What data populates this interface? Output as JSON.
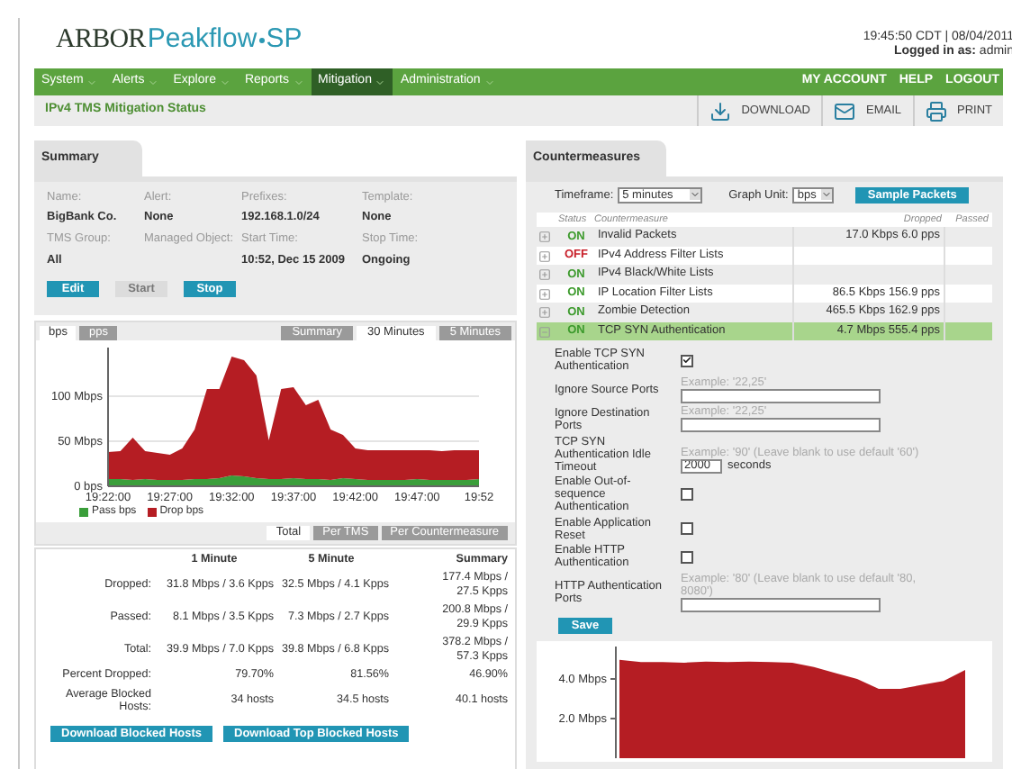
{
  "header": {
    "logo_brand": "ARBOR",
    "logo_product": "Peakflow",
    "logo_suffix": "SP",
    "datetime": "19:45:50 CDT | 08/04/2011",
    "login_label": "Logged in as:",
    "login_user": "admin"
  },
  "nav": {
    "menus": [
      {
        "label": "System",
        "selected": false
      },
      {
        "label": "Alerts",
        "selected": false
      },
      {
        "label": "Explore",
        "selected": false
      },
      {
        "label": "Reports",
        "selected": false
      },
      {
        "label": "Mitigation",
        "selected": true
      },
      {
        "label": "Administration",
        "selected": false
      }
    ],
    "links": [
      "MY ACCOUNT",
      "HELP",
      "LOGOUT"
    ]
  },
  "toolbar": {
    "title": "IPv4 TMS Mitigation Status",
    "actions": [
      {
        "kind": "download",
        "label": "DOWNLOAD"
      },
      {
        "kind": "email",
        "label": "EMAIL"
      },
      {
        "kind": "print",
        "label": "PRINT"
      }
    ]
  },
  "summary": {
    "tab": "Summary",
    "fields": [
      {
        "label": "Name:",
        "value": "BigBank Co."
      },
      {
        "label": "Alert:",
        "value": "None"
      },
      {
        "label": "Prefixes:",
        "value": "192.168.1.0/24"
      },
      {
        "label": "Template:",
        "value": "None"
      },
      {
        "label": "TMS Group:",
        "value": "All"
      },
      {
        "label": "Managed Object:"
      },
      {
        "label": "Start Time:",
        "value": "10:52, Dec 15 2009"
      },
      {
        "label": "Stop Time:",
        "value": "Ongoing"
      }
    ],
    "buttons": [
      {
        "label": "Edit",
        "disabled": false
      },
      {
        "label": "Start",
        "disabled": true
      },
      {
        "label": "Stop",
        "disabled": false
      }
    ]
  },
  "graph": {
    "unit_tabs": [
      {
        "label": "bps",
        "selected": true
      },
      {
        "label": "pps",
        "selected": false
      }
    ],
    "range_tabs": [
      {
        "label": "Summary",
        "selected": false
      },
      {
        "label": "30 Minutes",
        "selected": true
      },
      {
        "label": "5 Minutes",
        "selected": false
      }
    ],
    "chart_data": {
      "type": "area",
      "stacked": true,
      "categories": [
        "19:22:00",
        null,
        null,
        null,
        null,
        "19:27:00",
        null,
        null,
        null,
        null,
        "19:32:00",
        null,
        null,
        null,
        null,
        "19:37:00",
        null,
        null,
        null,
        null,
        "19:42:00",
        null,
        null,
        null,
        null,
        "19:47:00",
        null,
        null,
        null,
        null,
        "19:52"
      ],
      "ylim": [
        0,
        150
      ],
      "yticks": [
        {
          "value": 0,
          "label": "0 bps"
        },
        {
          "value": 50,
          "label": "50 Mbps"
        },
        {
          "value": 100,
          "label": "100 Mbps"
        }
      ],
      "series": [
        {
          "name": "Pass bps",
          "color": "#3a9e3a",
          "values": [
            8,
            8,
            7,
            8,
            7,
            7,
            7,
            8,
            8,
            9,
            12,
            11,
            9,
            8,
            8,
            9,
            8,
            8,
            7,
            9,
            8,
            7,
            7,
            7,
            7,
            8,
            7,
            7,
            7,
            7,
            8
          ]
        },
        {
          "name": "Drop bps",
          "color": "#b51d23",
          "values": [
            30,
            31,
            47,
            31,
            30,
            28,
            35,
            55,
            100,
            99,
            132,
            129,
            114,
            43,
            100,
            101,
            82,
            88,
            56,
            48,
            34,
            33,
            33,
            33,
            33,
            32,
            33,
            32,
            33,
            33,
            32
          ]
        }
      ]
    },
    "view_tabs": [
      {
        "label": "Total",
        "selected": true
      },
      {
        "label": "Per TMS",
        "selected": false
      },
      {
        "label": "Per Countermeasure",
        "selected": false
      }
    ]
  },
  "stats": {
    "columns": [
      "1 Minute",
      "5 Minute",
      "Summary"
    ],
    "rows": [
      {
        "label": "Dropped:",
        "cells": [
          "31.8 Mbps / 3.6 Kpps",
          "32.5 Mbps / 4.1 Kpps",
          "177.4 Mbps / 27.5 Kpps"
        ]
      },
      {
        "label": "Passed:",
        "cells": [
          "8.1 Mbps / 3.5 Kpps",
          "7.3 Mbps / 2.7 Kpps",
          "200.8 Mbps / 29.9 Kpps"
        ]
      },
      {
        "label": "Total:",
        "cells": [
          "39.9 Mbps / 7.0 Kpps",
          "39.8 Mbps / 6.8 Kpps",
          "378.2 Mbps / 57.3 Kpps"
        ]
      },
      {
        "label": "Percent Dropped:",
        "cells": [
          "79.70%",
          "81.56%",
          "46.90%"
        ]
      },
      {
        "label": "Average Blocked Hosts:",
        "cells": [
          "34  hosts",
          "34.5  hosts",
          "40.1  hosts"
        ]
      }
    ],
    "buttons": [
      "Download Blocked Hosts",
      "Download Top Blocked Hosts"
    ]
  },
  "countermeasures": {
    "tab": "Countermeasures",
    "timeframe_label": "Timeframe:",
    "timeframe": "5 minutes",
    "unit_label": "Graph Unit:",
    "unit": "bps",
    "sample_button": "Sample Packets",
    "columns": [
      "Status",
      "Countermeasure",
      "Dropped",
      "Passed"
    ],
    "rows": [
      {
        "status": "ON",
        "on": true,
        "name": "Invalid Packets",
        "dropped": "17.0 Kbps 6.0 pps",
        "expanded": false
      },
      {
        "status": "OFF",
        "on": false,
        "name": "IPv4 Address Filter Lists",
        "expanded": false
      },
      {
        "status": "ON",
        "on": true,
        "name": "IPv4 Black/White Lists",
        "expanded": false
      },
      {
        "status": "ON",
        "on": true,
        "name": "IP Location Filter Lists",
        "dropped": "86.5 Kbps 156.9 pps",
        "expanded": false
      },
      {
        "status": "ON",
        "on": true,
        "name": "Zombie Detection",
        "dropped": "465.5 Kbps 162.9 pps",
        "expanded": false
      },
      {
        "status": "ON",
        "on": true,
        "name": "TCP SYN Authentication",
        "dropped": "4.7 Mbps 555.4 pps",
        "expanded": true
      }
    ],
    "settings": [
      {
        "kind": "checkbox",
        "label": "Enable TCP SYN Authentication",
        "checked": true
      },
      {
        "kind": "text",
        "label": "Ignore Source Ports",
        "example": "Example:  '22,25'"
      },
      {
        "kind": "text",
        "label": "Ignore Destination Ports",
        "example": "Example:  '22,25'"
      },
      {
        "kind": "text",
        "label": "TCP SYN Authentication Idle Timeout",
        "example": "Example: '90' (Leave blank to use default '60')",
        "value": "2000",
        "unit": "seconds"
      },
      {
        "kind": "checkbox",
        "label": "Enable Out-of-sequence Authentication",
        "checked": false
      },
      {
        "kind": "checkbox",
        "label": "Enable Application Reset",
        "checked": false
      },
      {
        "kind": "checkbox",
        "label": "Enable HTTP Authentication",
        "checked": false
      },
      {
        "kind": "text",
        "label": "HTTP Authentication Ports",
        "example": "Example: '80' (Leave blank to use default '80, 8080')"
      }
    ],
    "save_button": "Save",
    "traffic_graph": {
      "axis_labels": [
        "4.0 Mbps",
        "2.0 Mbps"
      ]
    }
  }
}
